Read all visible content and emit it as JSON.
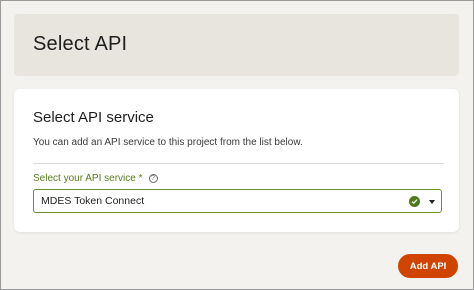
{
  "header": {
    "title": "Select API"
  },
  "card": {
    "title": "Select API service",
    "description": "You can add an API service to this project from the list below.",
    "field": {
      "label": "Select your API service *",
      "help_icon": "?",
      "selected_value": "MDES Token Connect",
      "status_icon": "check-circle-icon",
      "dropdown_icon": "caret-down-icon"
    }
  },
  "actions": {
    "add_label": "Add API"
  },
  "colors": {
    "accent": "#cf4500",
    "field_border": "#6b8f2a",
    "label_green": "#5a7a1e",
    "check_green": "#4f7a1c"
  }
}
